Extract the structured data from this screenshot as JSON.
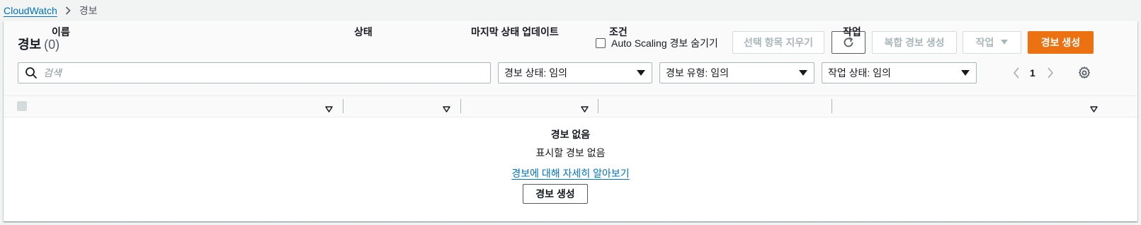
{
  "breadcrumb": {
    "root": "CloudWatch",
    "current": "경보"
  },
  "header": {
    "title": "경보",
    "count": "(0)",
    "hide_autoscaling_label": "Auto Scaling 경보 숨기기",
    "hide_autoscaling_checked": false,
    "clear_selection_label": "선택 항목 지우기",
    "create_composite_label": "복합 경보 생성",
    "actions_label": "작업",
    "create_alarm_label": "경보 생성"
  },
  "filters": {
    "search_placeholder": "검색",
    "alarm_state": "경보 상태: 임의",
    "alarm_type": "경보 유형: 임의",
    "action_state": "작업 상태: 임의"
  },
  "pagination": {
    "current_page": "1"
  },
  "table": {
    "columns": [
      "이름",
      "상태",
      "마지막 상태 업데이트",
      "조건",
      "작업"
    ]
  },
  "empty_state": {
    "title": "경보 없음",
    "description": "표시할 경보 없음",
    "learn_more_link": "경보에 대해 자세히 알아보기",
    "create_button": "경보 생성"
  },
  "colors": {
    "primary": "#ec7211",
    "link": "#0073bb",
    "text": "#16191f",
    "disabled": "#aab7b8"
  }
}
